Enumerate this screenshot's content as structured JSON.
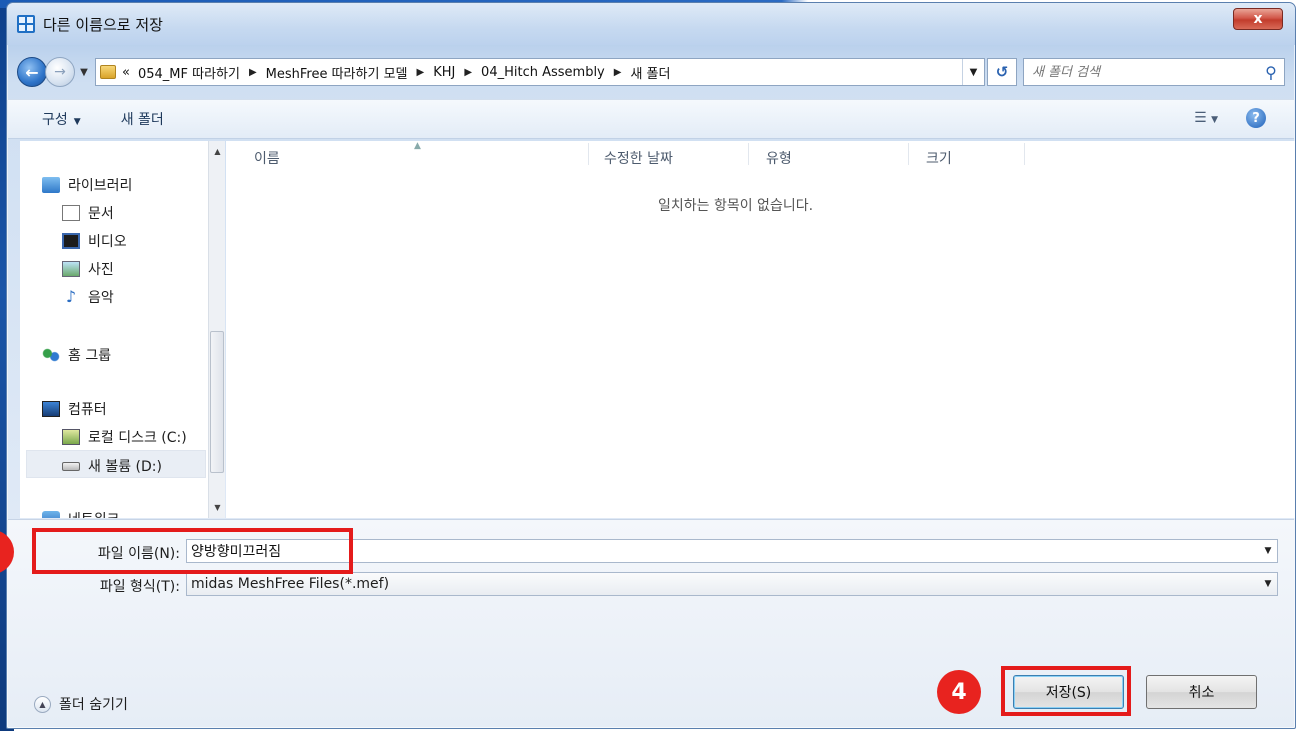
{
  "window": {
    "title": "다른 이름으로 저장",
    "close_label": "x"
  },
  "address_bar": {
    "overflow": "«",
    "crumbs": [
      "054_MF 따라하기",
      "MeshFree 따라하기 모델",
      "KHJ",
      "04_Hitch Assembly",
      "새 폴더"
    ],
    "search_placeholder": "새 폴더 검색"
  },
  "toolbar": {
    "organize_label": "구성",
    "new_folder_label": "새 폴더"
  },
  "nav_pane": {
    "libraries": "라이브러리",
    "documents": "문서",
    "videos": "비디오",
    "pictures": "사진",
    "music": "음악",
    "homegroup": "홈 그룹",
    "computer": "컴퓨터",
    "local_disk": "로컬 디스크 (C:)",
    "new_volume": "새 볼륨 (D:)",
    "network": "네트워크"
  },
  "file_list": {
    "columns": [
      "이름",
      "수정한 날짜",
      "유형",
      "크기"
    ],
    "empty_message": "일치하는 항목이 없습니다."
  },
  "form": {
    "filename_label": "파일 이름(N):",
    "filename_value": "양방향미끄러짐",
    "filetype_label": "파일 형식(T):",
    "filetype_value": "midas MeshFree Files(*.mef)",
    "hide_folders_label": "폴더 숨기기",
    "save_label": "저장(S)",
    "cancel_label": "취소"
  },
  "annotations": {
    "step_save": "4",
    "accent_color": "#e41b1b"
  }
}
